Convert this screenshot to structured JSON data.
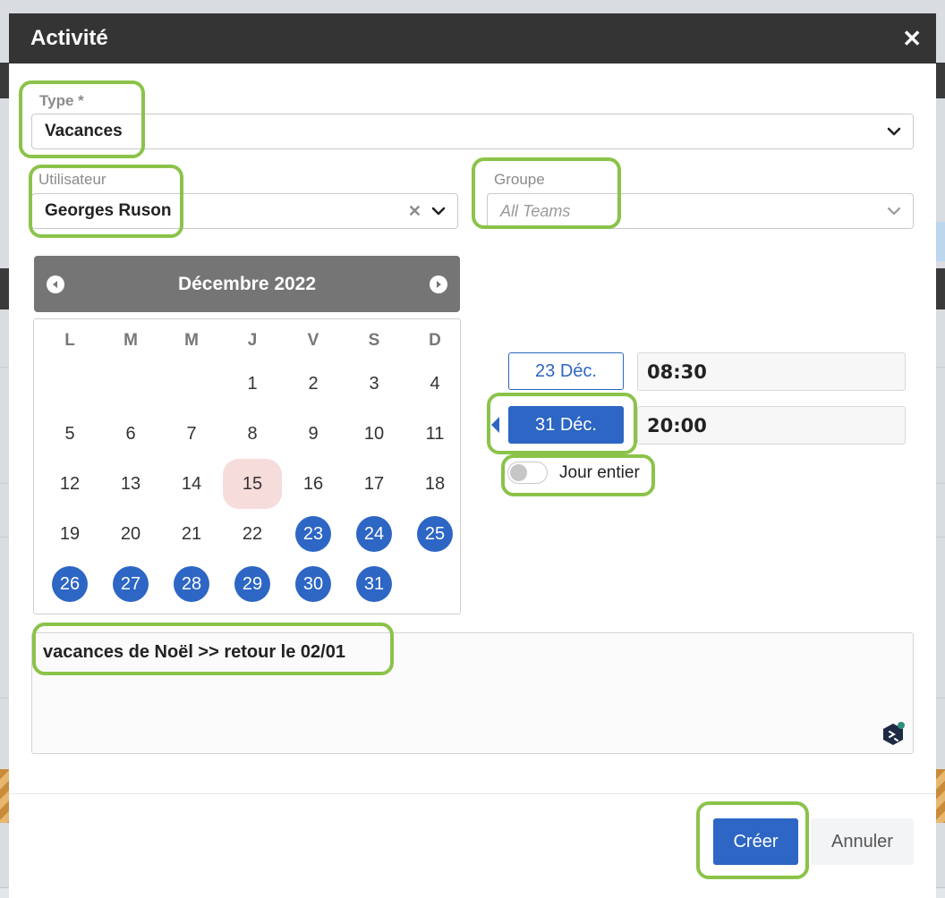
{
  "colors": {
    "accent": "#2d66c4",
    "highlight": "#8bc34a",
    "header": "#343434",
    "today": "#f7dcdc"
  },
  "modal": {
    "title": "Activité",
    "close_icon": "close-icon"
  },
  "type_field": {
    "label": "Type *",
    "value": "Vacances"
  },
  "user_field": {
    "label": "Utilisateur",
    "value": "Georges Ruson"
  },
  "group_field": {
    "label": "Groupe",
    "placeholder": "All Teams"
  },
  "calendar": {
    "month_title": "Décembre 2022",
    "weekdays": [
      "L",
      "M",
      "M",
      "J",
      "V",
      "S",
      "D"
    ],
    "today": 15,
    "selected_range": [
      23,
      31
    ],
    "weeks": [
      [
        "",
        "",
        "",
        "1",
        "2",
        "3",
        "4"
      ],
      [
        "5",
        "6",
        "7",
        "8",
        "9",
        "10",
        "11"
      ],
      [
        "12",
        "13",
        "14",
        "15",
        "16",
        "17",
        "18"
      ],
      [
        "19",
        "20",
        "21",
        "22",
        "23",
        "24",
        "25"
      ],
      [
        "26",
        "27",
        "28",
        "29",
        "30",
        "31",
        ""
      ]
    ]
  },
  "period": {
    "start_date": "23 Déc.",
    "start_time": "08:30",
    "end_date": "31 Déc.",
    "end_time": "20:00",
    "all_day_label": "Jour entier",
    "all_day_on": false
  },
  "notes": {
    "value": "vacances de Noël >> retour le 02/01"
  },
  "footer": {
    "create_label": "Créer",
    "cancel_label": "Annuler"
  }
}
